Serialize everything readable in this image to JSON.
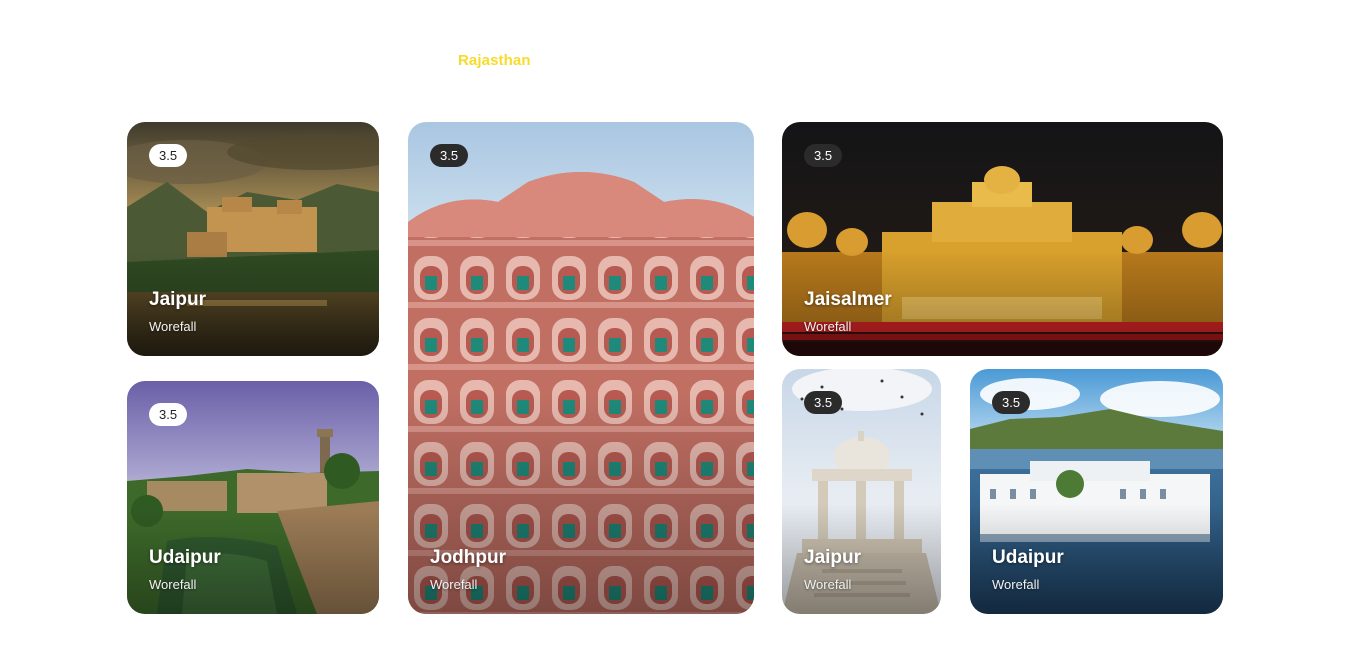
{
  "section": {
    "title": "Rajasthan"
  },
  "cards": [
    {
      "rating": "3.5",
      "title": "Jaipur",
      "subtitle": "Worefall"
    },
    {
      "rating": "3.5",
      "title": "Udaipur",
      "subtitle": "Worefall"
    },
    {
      "rating": "3.5",
      "title": "Jodhpur",
      "subtitle": "Worefall"
    },
    {
      "rating": "3.5",
      "title": "Jaisalmer",
      "subtitle": "Worefall"
    },
    {
      "rating": "3.5",
      "title": "Jaipur",
      "subtitle": "Worefall"
    },
    {
      "rating": "3.5",
      "title": "Udaipur",
      "subtitle": "Worefall"
    }
  ],
  "colors": {
    "accent": "#f5dc2b",
    "badge_light": "#ffffff",
    "badge_dark": "#2b2b2b"
  }
}
